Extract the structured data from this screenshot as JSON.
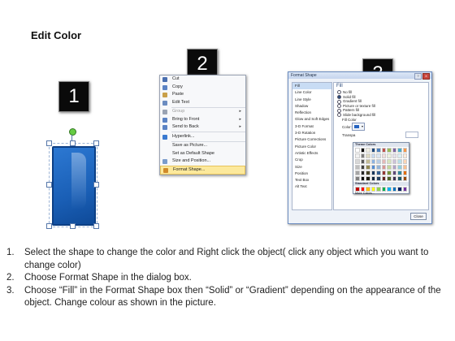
{
  "title": "Edit Color",
  "badges": [
    "1",
    "2",
    "3"
  ],
  "context_menu": {
    "items": [
      {
        "label": "Cut",
        "icon": "scissors-icon",
        "color": "#4a6fb0",
        "arrow": ""
      },
      {
        "label": "Copy",
        "icon": "copy-icon",
        "color": "#5b83c4",
        "arrow": ""
      },
      {
        "label": "Paste",
        "icon": "paste-icon",
        "color": "#c9a04a",
        "arrow": ""
      },
      {
        "label": "Edit Text",
        "icon": "edit-text-icon",
        "color": "#6b8cc0",
        "arrow": ""
      },
      {
        "label": "Group",
        "icon": "group-icon",
        "color": "#9aa3b3",
        "arrow": "▸",
        "disabled": true
      },
      {
        "label": "Bring to Front",
        "icon": "bring-front-icon",
        "color": "#5b83c4",
        "arrow": "▸"
      },
      {
        "label": "Send to Back",
        "icon": "send-back-icon",
        "color": "#5b83c4",
        "arrow": "▸"
      },
      {
        "label": "Hyperlink...",
        "icon": "hyperlink-icon",
        "color": "#3a7ad0",
        "arrow": ""
      },
      {
        "label": "Save as Picture...",
        "icon": "",
        "color": "",
        "arrow": ""
      },
      {
        "label": "Set as Default Shape",
        "icon": "",
        "color": "",
        "arrow": ""
      },
      {
        "label": "Size and Position...",
        "icon": "size-position-icon",
        "color": "#7a9ccc",
        "arrow": ""
      },
      {
        "label": "Format Shape...",
        "icon": "format-shape-icon",
        "color": "#d08a2a",
        "arrow": "",
        "highlighted": true
      }
    ]
  },
  "dialog": {
    "title": "Format Shape",
    "help": "?",
    "close_x": "X",
    "categories": [
      "Fill",
      "Line Color",
      "Line Style",
      "Shadow",
      "Reflection",
      "Glow and Soft Edges",
      "3-D Format",
      "3-D Rotation",
      "Picture Corrections",
      "Picture Color",
      "Artistic Effects",
      "Crop",
      "Size",
      "Position",
      "Text Box",
      "Alt Text"
    ],
    "selected_category": "Fill",
    "fill_heading": "Fill",
    "options": [
      "No fill",
      "Solid fill",
      "Gradient fill",
      "Picture or texture fill",
      "Pattern fill",
      "Slide background fill"
    ],
    "selected_option": "Solid fill",
    "fill_color_label": "Fill Color",
    "color_label": "Color:",
    "transparency_label": "Transpa",
    "close_button": "Close",
    "palette": {
      "theme_heading": "Theme Colors",
      "standard_heading": "Standard Colors",
      "more_colors": "More Colors...",
      "theme_rows": [
        [
          "#ffffff",
          "#000000",
          "#eeece1",
          "#1f497d",
          "#4f81bd",
          "#c0504d",
          "#9bbb59",
          "#8064a2",
          "#4bacc6",
          "#f79646"
        ],
        [
          "#f2f2f2",
          "#7f7f7f",
          "#ddd9c3",
          "#c6d9f0",
          "#dbe5f1",
          "#f2dcdb",
          "#ebf1dd",
          "#e5e0ec",
          "#dbeef3",
          "#fdeada"
        ],
        [
          "#d8d8d8",
          "#595959",
          "#c4bd97",
          "#8db3e2",
          "#b8cce4",
          "#e5b9b7",
          "#d7e3bc",
          "#ccc1d9",
          "#b7dde8",
          "#fbd5b5"
        ],
        [
          "#bfbfbf",
          "#3f3f3f",
          "#938953",
          "#548dd4",
          "#95b3d7",
          "#d99694",
          "#c3d69b",
          "#b2a2c7",
          "#92cddc",
          "#fac08f"
        ],
        [
          "#a5a5a5",
          "#262626",
          "#494429",
          "#17365d",
          "#366092",
          "#953734",
          "#76923c",
          "#5f497a",
          "#31859b",
          "#e36c09"
        ],
        [
          "#7f7f7f",
          "#0c0c0c",
          "#1d1b10",
          "#0f243e",
          "#244061",
          "#632423",
          "#4f6128",
          "#3f3151",
          "#205867",
          "#974806"
        ]
      ],
      "standard_row": [
        "#c00000",
        "#ff0000",
        "#ffc000",
        "#ffff00",
        "#92d050",
        "#00b050",
        "#00b0f0",
        "#0070c0",
        "#002060",
        "#7030a0"
      ]
    }
  },
  "steps": [
    {
      "num": "1.",
      "text": "Select the shape to change the color and Right click the object( click any object which you want to change color)"
    },
    {
      "num": "2.",
      "text": "Choose Format Shape in the dialog box."
    },
    {
      "num": "3.",
      "text": "Choose “Fill” in the Format Shape box then “Solid” or “Gradient” depending on the appearance of the object. Change colour as shown in the picture."
    }
  ],
  "colors": {
    "shape_fill": "#1a5fb6",
    "menu_highlight": "#fce99c",
    "dialog_border": "#6b8cc0"
  }
}
